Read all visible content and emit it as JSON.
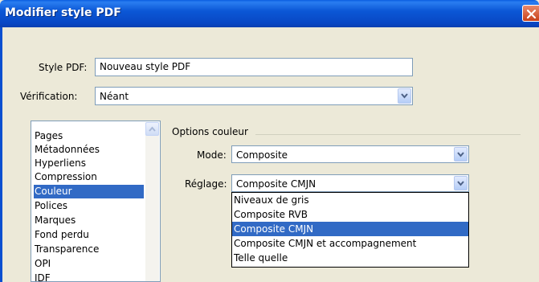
{
  "window": {
    "title": "Modifier style PDF"
  },
  "style_pdf": {
    "label": "Style PDF:",
    "value": "Nouveau style PDF"
  },
  "verification": {
    "label": "Vérification:",
    "value": "Néant"
  },
  "sections": {
    "items": [
      "Pages",
      "Métadonnées",
      "Hyperliens",
      "Compression",
      "Couleur",
      "Polices",
      "Marques",
      "Fond perdu",
      "Transparence",
      "OPI",
      "JDF"
    ],
    "selected": "Couleur"
  },
  "options_couleur": {
    "group_label": "Options couleur",
    "mode_label": "Mode:",
    "mode_value": "Composite",
    "reglage_label": "Réglage:",
    "reglage_value": "Composite CMJN",
    "reglage_options": [
      "Niveaux de gris",
      "Composite RVB",
      "Composite CMJN",
      "Composite CMJN et accompagnement",
      "Telle quelle"
    ],
    "reglage_highlighted": "Composite CMJN"
  },
  "icons": {
    "close": "close-icon",
    "dropdown": "chevron-down-icon",
    "scroll_up": "scroll-up-icon"
  },
  "colors": {
    "titlebar": "#0b57d6",
    "selection": "#316ac5",
    "dialog_bg": "#ece9d8"
  }
}
